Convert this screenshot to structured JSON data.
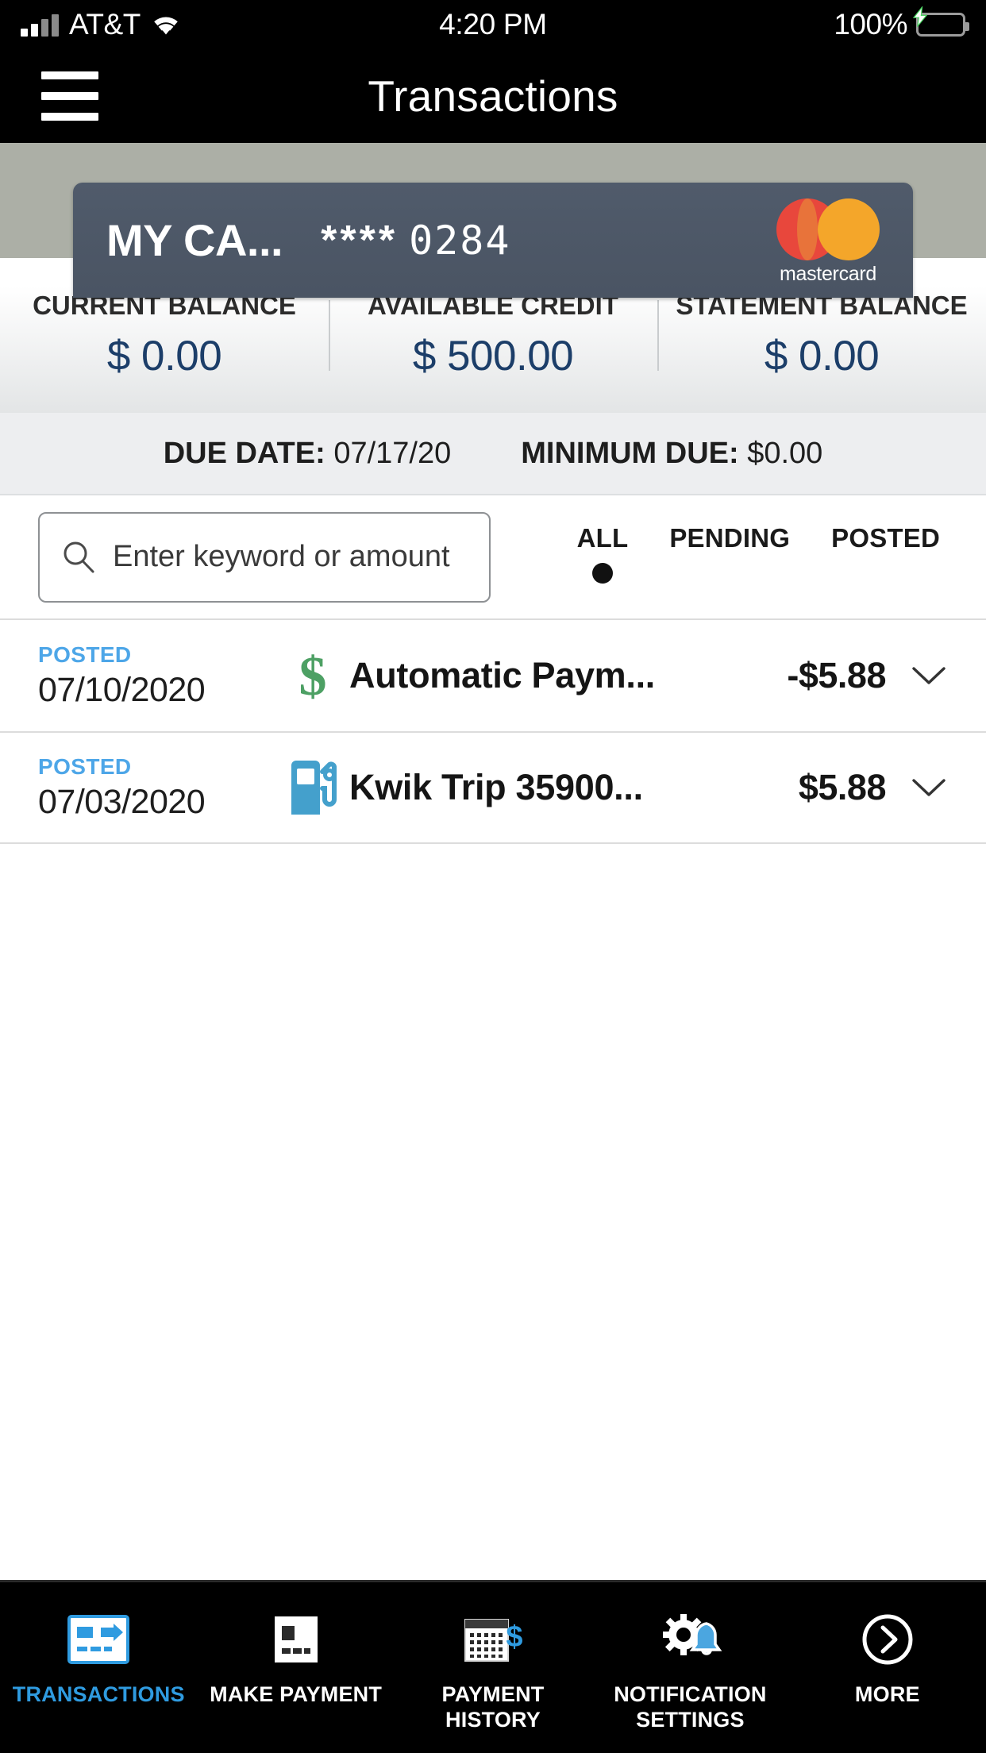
{
  "status_bar": {
    "carrier": "AT&T",
    "time": "4:20 PM",
    "battery_percent": "100%",
    "signal_icon": "cellular-signal-icon",
    "wifi_icon": "wifi-icon",
    "battery_icon": "battery-charging-icon"
  },
  "header": {
    "title": "Transactions",
    "menu_icon": "hamburger-menu-icon"
  },
  "card": {
    "name": "MY CA...",
    "mask": "****",
    "last_four": "0284",
    "network": "mastercard",
    "network_logo_icon": "mastercard-logo-icon",
    "background_color": "#4A5463",
    "hero_background_color": "#ACAFA6"
  },
  "balances": [
    {
      "label": "CURRENT BALANCE",
      "value": "$ 0.00"
    },
    {
      "label": "AVAILABLE CREDIT",
      "value": "$ 500.00"
    },
    {
      "label": "STATEMENT BALANCE",
      "value": "$ 0.00"
    }
  ],
  "balance_value_color": "#1C3E69",
  "due": {
    "due_date_label": "DUE DATE:",
    "due_date_value": "07/17/20",
    "minimum_due_label": "MINIMUM DUE:",
    "minimum_due_value": "$0.00"
  },
  "search": {
    "placeholder": "Enter keyword or amount",
    "value": "",
    "icon": "search-icon"
  },
  "filters": {
    "active": "ALL",
    "options": [
      {
        "label": "ALL",
        "selected": true
      },
      {
        "label": "PENDING",
        "selected": false
      },
      {
        "label": "POSTED",
        "selected": false
      }
    ]
  },
  "transactions": [
    {
      "status": "POSTED",
      "date": "07/10/2020",
      "description": "Automatic Paym...",
      "amount": "-$5.88",
      "icon": "dollar-sign-icon",
      "icon_color": "#4DA064",
      "expand_icon": "chevron-down-icon"
    },
    {
      "status": "POSTED",
      "date": "07/03/2020",
      "description": "Kwik Trip 35900...",
      "amount": "$5.88",
      "icon": "gas-pump-icon",
      "icon_color": "#44A0CC",
      "expand_icon": "chevron-down-icon"
    }
  ],
  "status_badge_color": "#4DA6E8",
  "tabbar": {
    "active": "TRANSACTIONS",
    "active_color": "#2F9BE0",
    "items": [
      {
        "label": "TRANSACTIONS",
        "icon": "transactions-card-icon",
        "active": true
      },
      {
        "label": "MAKE PAYMENT",
        "icon": "check-payment-icon",
        "active": false
      },
      {
        "label": "PAYMENT HISTORY",
        "icon": "calendar-dollar-icon",
        "active": false
      },
      {
        "label": "NOTIFICATION SETTINGS",
        "icon": "gear-bell-icon",
        "active": false
      },
      {
        "label": "MORE",
        "icon": "chevron-right-circle-icon",
        "active": false
      }
    ]
  }
}
